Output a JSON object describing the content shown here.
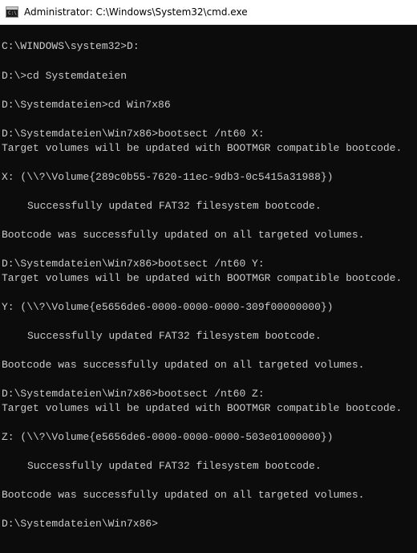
{
  "window": {
    "title": "Administrator: C:\\Windows\\System32\\cmd.exe",
    "icon": "cmd-icon",
    "icon_text": "C:\\"
  },
  "console": {
    "lines": [
      "C:\\WINDOWS\\system32>D:",
      "D:\\>cd Systemdateien",
      "D:\\Systemdateien>cd Win7x86",
      "D:\\Systemdateien\\Win7x86>bootsect /nt60 X:",
      "Target volumes will be updated with BOOTMGR compatible bootcode.",
      "X: (\\\\?\\Volume{289c0b55-7620-11ec-9db3-0c5415a31988})",
      "Successfully updated FAT32 filesystem bootcode.",
      "Bootcode was successfully updated on all targeted volumes.",
      "D:\\Systemdateien\\Win7x86>bootsect /nt60 Y:",
      "Target volumes will be updated with BOOTMGR compatible bootcode.",
      "Y: (\\\\?\\Volume{e5656de6-0000-0000-0000-309f00000000})",
      "Successfully updated FAT32 filesystem bootcode.",
      "Bootcode was successfully updated on all targeted volumes.",
      "D:\\Systemdateien\\Win7x86>bootsect /nt60 Z:",
      "Target volumes will be updated with BOOTMGR compatible bootcode.",
      "Z: (\\\\?\\Volume{e5656de6-0000-0000-0000-503e01000000})",
      "Successfully updated FAT32 filesystem bootcode.",
      "Bootcode was successfully updated on all targeted volumes.",
      "D:\\Systemdateien\\Win7x86>"
    ]
  },
  "colors": {
    "console_background": "#0c0c0c",
    "console_text": "#cccccc",
    "titlebar_background": "#ffffff"
  }
}
